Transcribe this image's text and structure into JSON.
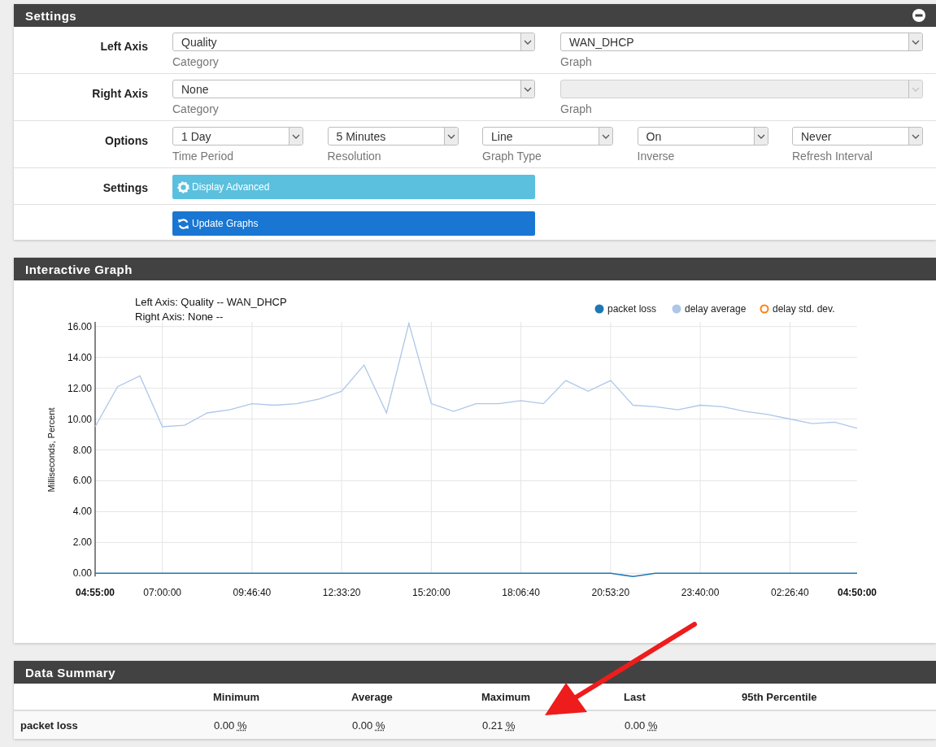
{
  "settings_panel": {
    "title": "Settings",
    "rows": [
      {
        "kind": "selects",
        "label": "Left Axis",
        "fields": [
          {
            "value": "Quality",
            "caption": "Category",
            "disabled": false
          },
          {
            "value": "WAN_DHCP",
            "caption": "Graph",
            "disabled": false
          }
        ]
      },
      {
        "kind": "selects",
        "label": "Right Axis",
        "fields": [
          {
            "value": "None",
            "caption": "Category",
            "disabled": false
          },
          {
            "caption": "Graph",
            "disabled": true
          }
        ]
      },
      {
        "kind": "selects",
        "label": "Options",
        "fields": [
          {
            "value": "1 Day",
            "caption": "Time Period",
            "disabled": false
          },
          {
            "value": "5 Minutes",
            "caption": "Resolution",
            "disabled": false
          },
          {
            "value": "Line",
            "caption": "Graph Type",
            "disabled": false
          },
          {
            "value": "On",
            "caption": "Inverse",
            "disabled": false
          },
          {
            "value": "Never",
            "caption": "Refresh Interval",
            "disabled": false
          }
        ]
      },
      {
        "kind": "button",
        "label": "Settings",
        "button": {
          "kind": "info",
          "text": "Display Advanced"
        }
      },
      {
        "kind": "button",
        "button": {
          "kind": "primary",
          "text": "Update Graphs"
        }
      }
    ]
  },
  "graph_panel": {
    "title": "Interactive Graph",
    "legend_items": [
      {
        "hidden": false
      },
      {
        "hidden": false
      },
      {
        "hidden": true
      }
    ],
    "axis_captions": [
      "Left Axis: Quality -- WAN_DHCP",
      "Right Axis: None --"
    ],
    "chart_data": {
      "type": "line",
      "ylabel": "Milliseconds, Percent",
      "categories": [
        "04:55:00",
        null,
        null,
        "07:00:00",
        null,
        null,
        null,
        "09:46:40",
        null,
        null,
        null,
        "12:33:20",
        null,
        null,
        null,
        "15:20:00",
        null,
        null,
        null,
        "18:06:40",
        null,
        null,
        null,
        "20:53:20",
        null,
        null,
        null,
        "23:40:00",
        null,
        null,
        null,
        "02:26:40",
        null,
        null,
        "04:50:00"
      ],
      "ylim": [
        -0.3,
        16.3
      ],
      "grid": true,
      "legend": "top-right",
      "yticks": [
        {
          "value": 0,
          "label": "0.00"
        },
        {
          "value": 2,
          "label": "2.00"
        },
        {
          "value": 4,
          "label": "4.00"
        },
        {
          "value": 6,
          "label": "6.00"
        },
        {
          "value": 8,
          "label": "8.00"
        },
        {
          "value": 10,
          "label": "10.00"
        },
        {
          "value": 12,
          "label": "12.00"
        },
        {
          "value": 14,
          "label": "14.00"
        },
        {
          "value": 16,
          "label": "16.00"
        }
      ],
      "series": [
        {
          "name": "packet loss",
          "color": "#1f77b4",
          "values": [
            0,
            0,
            0,
            0,
            0,
            0,
            0,
            0,
            0,
            0,
            0,
            0,
            0,
            0,
            0,
            0,
            0,
            0,
            0,
            0,
            0,
            0,
            0,
            0,
            -0.21,
            0,
            0,
            0,
            0,
            0,
            0,
            0,
            0,
            0,
            0
          ]
        },
        {
          "name": "delay average",
          "color": "#aec7e8",
          "values": [
            9.5,
            12.1,
            12.8,
            9.5,
            9.6,
            10.4,
            10.6,
            11.0,
            10.9,
            11.0,
            11.3,
            11.8,
            13.5,
            10.4,
            16.2,
            11.0,
            10.5,
            11.0,
            11.0,
            11.2,
            11.0,
            12.5,
            11.8,
            12.5,
            10.9,
            10.8,
            10.6,
            10.9,
            10.8,
            10.5,
            10.3,
            10.0,
            9.7,
            9.8,
            9.4
          ]
        },
        {
          "name": "delay std. dev.",
          "color": "#ff7f0e",
          "values": [
            null,
            null,
            null,
            null,
            null,
            null,
            null,
            null,
            null,
            null,
            null,
            null,
            null,
            null,
            null,
            null,
            null,
            null,
            null,
            null,
            null,
            null,
            null,
            null,
            null,
            null,
            null,
            null,
            null,
            null,
            null,
            null,
            null,
            null,
            null
          ]
        }
      ]
    }
  },
  "summary_panel": {
    "title": "Data Summary",
    "columns": [
      "Minimum",
      "Average",
      "Maximum",
      "Last",
      "95th Percentile"
    ],
    "rows": [
      {
        "name": "packet loss",
        "cells": [
          {
            "value": "0.00",
            "unit": "%"
          },
          {
            "value": "0.00",
            "unit": "%"
          },
          {
            "value": "0.21",
            "unit": "%"
          },
          {
            "value": "0.00",
            "unit": "%"
          }
        ]
      }
    ]
  }
}
